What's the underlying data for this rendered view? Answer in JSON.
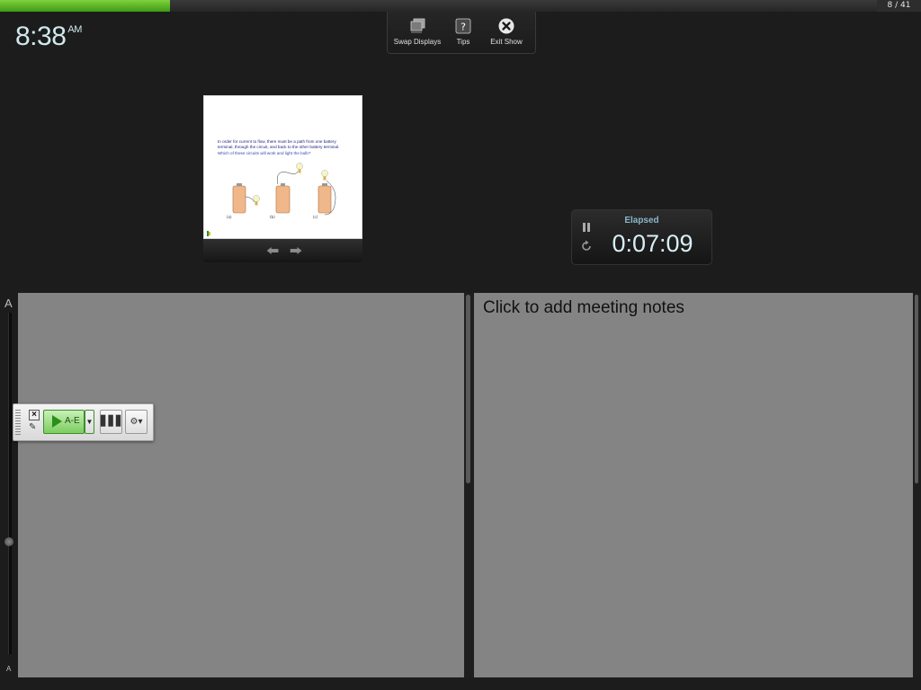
{
  "progress": {
    "slide_counter": "8 / 41",
    "fraction": 0.185
  },
  "clock": {
    "time": "8:38",
    "ampm": "AM"
  },
  "toolbar": {
    "swap_label": "Swap Displays",
    "tips_label": "Tips",
    "exit_label": "Exit Show"
  },
  "slide": {
    "text_line1": "In order for current to flow, there must be a path from one battery",
    "text_line2": "terminal, through the circuit, and back to the other battery terminal.",
    "question": "Which of these circuits will work and light the bulb?",
    "label_a": "(a)",
    "label_b": "(b)",
    "label_c": "(c)"
  },
  "timer": {
    "label": "Elapsed",
    "value": "0:07:09"
  },
  "zoom": {
    "large_label": "A",
    "small_label": "A"
  },
  "notes": {
    "placeholder": "Click to add meeting notes"
  },
  "poll_toolbar": {
    "play_label": "A-E"
  }
}
